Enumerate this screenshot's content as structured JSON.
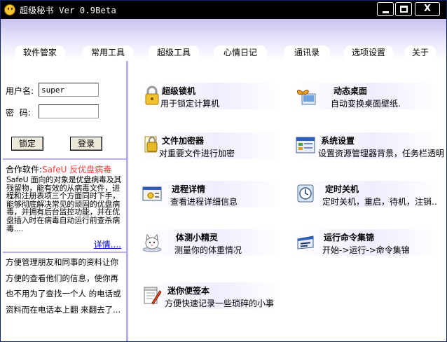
{
  "window": {
    "title": "超级秘书 Ver 0.9Beta",
    "controls": {
      "minimize": "",
      "maximize": "",
      "close": "X"
    }
  },
  "tabs": [
    "软件管家",
    "常用工具",
    "超级工具",
    "心情日记",
    "通讯录",
    "选项设置",
    "关于"
  ],
  "login": {
    "username_label": "用户名:",
    "username_value": "super",
    "password_label": "密  码:",
    "password_value": "",
    "lock_button": "锁定",
    "login_button": "登录"
  },
  "partner": {
    "heading": "合作软件:",
    "product": "SafeU 反优盘病毒",
    "description": "SafeU 面向的对象是优盘病毒及其残留物，能有效的从病毒文件，进程和注册表项三个方面同时下手，能够彻底解决常见的顽固的优盘病毒，并拥有后台监控功能，并在优盘插入时在病毒自动运行前查杀病毒....",
    "more_link": "详情...."
  },
  "contacts_text": "方便管理朋友和同事的资料让你方便的查看他们的信息，使你再也不用为了查找一个人 的电话或资料而在电话本上翻 来翻去了...",
  "features": {
    "super_lock": {
      "title": "超级锁机",
      "desc": "用于锁定计算机"
    },
    "dynamic_desktop": {
      "title": "动态桌面",
      "desc": "自动变换桌面壁纸."
    },
    "file_encryptor": {
      "title": "文件加密器",
      "desc": "对重要文件进行加密"
    },
    "system_settings": {
      "title": "系统设置",
      "desc": "设置资源管理器背景，任务栏透明"
    },
    "process_details": {
      "title": "进程详情",
      "desc": "查看进程详细信息"
    },
    "timed_shutdown": {
      "title": "定时关机",
      "desc": "定时关机，重启，待机，注销.."
    },
    "body_weight": {
      "title": "体测小精灵",
      "desc": "测量你的体重情况"
    },
    "run_commands": {
      "title": "运行命令集锦",
      "desc": "开始->运行->命令集锦"
    },
    "mini_notes": {
      "title": "迷你便签本",
      "desc": "方便快速记录一些琐碎的小事"
    }
  },
  "colors": {
    "accent": "#b8b0ec",
    "titlebar": "#000000",
    "link": "#0000cc",
    "partner_red": "#ff3b3b"
  }
}
